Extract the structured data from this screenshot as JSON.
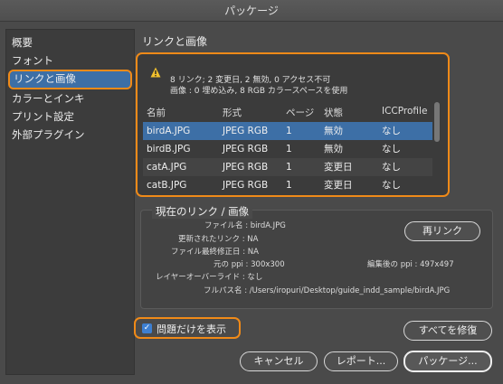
{
  "window": {
    "title": "パッケージ"
  },
  "sidebar": {
    "items": [
      {
        "label": "概要"
      },
      {
        "label": "フォント"
      },
      {
        "label": "リンクと画像"
      },
      {
        "label": "カラーとインキ"
      },
      {
        "label": "プリント設定"
      },
      {
        "label": "外部プラグイン"
      }
    ]
  },
  "section": {
    "title": "リンクと画像"
  },
  "warning": {
    "line1": "8 リンク; 2 変更日, 2 無効, 0 アクセス不可",
    "line2": "画像 : 0 埋め込み, 8 RGB カラースペースを使用"
  },
  "table": {
    "headers": [
      "名前",
      "形式",
      "ページ",
      "状態",
      "ICCProfile"
    ],
    "rows": [
      [
        "birdA.JPG",
        "JPEG RGB",
        "1",
        "無効",
        "なし"
      ],
      [
        "birdB.JPG",
        "JPEG RGB",
        "1",
        "無効",
        "なし"
      ],
      [
        "catA.JPG",
        "JPEG RGB",
        "1",
        "変更日",
        "なし"
      ],
      [
        "catB.JPG",
        "JPEG RGB",
        "1",
        "変更日",
        "なし"
      ]
    ]
  },
  "current": {
    "title": "現在のリンク / 画像",
    "filename": "ファイル名 : birdA.JPG",
    "updated": "更新されたリンク : NA",
    "modified": "ファイル最終修正日 : NA",
    "ppi": "元の ppi : 300x300",
    "edited_ppi": "編集後の ppi : 497x497",
    "override": "レイヤーオーバーライド : なし",
    "path": "フルパス名 : /Users/iropuri/Desktop/guide_indd_sample/birdA.JPG",
    "relink_label": "再リンク"
  },
  "problems_only": {
    "label": "問題だけを表示",
    "checked": true
  },
  "buttons": {
    "fix_all": "すべてを修復",
    "cancel": "キャンセル",
    "report": "レポート...",
    "package": "パッケージ..."
  },
  "colors": {
    "selection": "#3d6fa6",
    "highlight": "#f08a18",
    "checkbox": "#3d7fd1"
  }
}
